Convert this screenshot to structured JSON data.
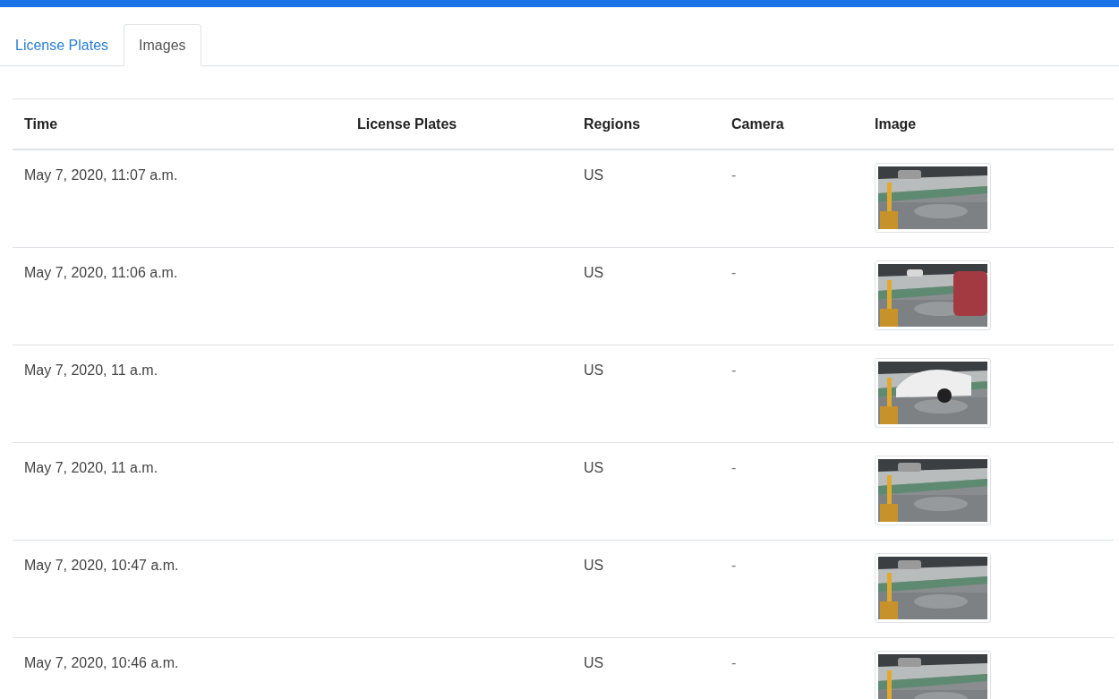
{
  "tabs": [
    {
      "label": "License Plates",
      "selected": false
    },
    {
      "label": "Images",
      "selected": true
    }
  ],
  "table": {
    "columns": [
      "Time",
      "License Plates",
      "Regions",
      "Camera",
      "Image"
    ],
    "rows": [
      {
        "time": "May 7, 2020, 11:07 a.m.",
        "regions": "US",
        "camera": "-"
      },
      {
        "time": "May 7, 2020, 11:06 a.m.",
        "regions": "US",
        "camera": "-"
      },
      {
        "time": "May 7, 2020, 11 a.m.",
        "regions": "US",
        "camera": "-"
      },
      {
        "time": "May 7, 2020, 11 a.m.",
        "regions": "US",
        "camera": "-"
      },
      {
        "time": "May 7, 2020, 10:47 a.m.",
        "regions": "US",
        "camera": "-"
      },
      {
        "time": "May 7, 2020, 10:46 a.m.",
        "regions": "US",
        "camera": "-"
      }
    ]
  }
}
